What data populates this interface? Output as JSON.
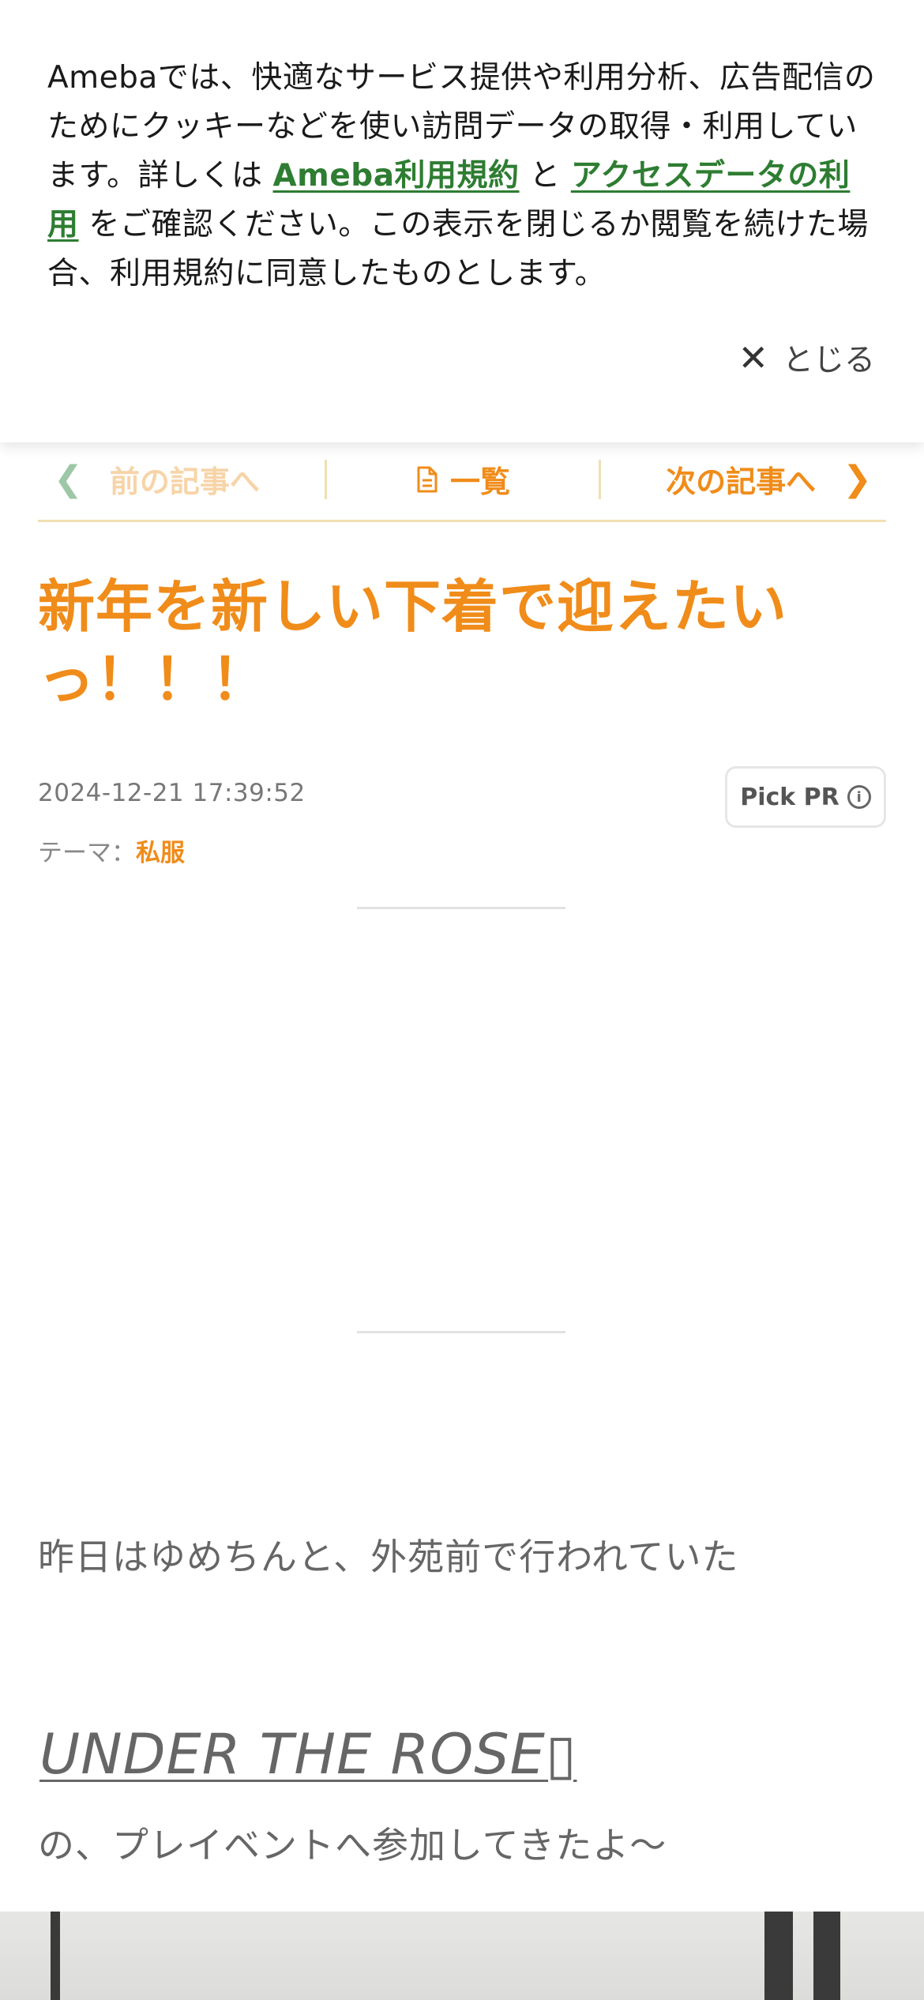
{
  "cookie_banner": {
    "text_before": "Amebaでは、快適なサービス提供や利用分析、広告配信のためにクッキーなどを使い訪問データの取得・利用しています。詳しくは ",
    "link_terms": "Ameba利用規約",
    "text_and": " と ",
    "link_access": "アクセスデータの利用",
    "text_after": " をご確認ください。この表示を閉じるか閲覧を続けた場合、利用規約に同意したものとします。",
    "close_label": "とじる"
  },
  "nav": {
    "prev_label": "前の記事へ",
    "list_label": "一覧",
    "next_label": "次の記事へ"
  },
  "entry": {
    "title": "新年を新しい下着で迎えたいっ！！！",
    "date": "2024-12-21 17:39:52",
    "theme_label": "テーマ：",
    "theme_value": "私服",
    "pick_pr_label": "Pick PR"
  },
  "body": {
    "line1": "昨日はゆめちんと、外苑前で行われていた",
    "link": "UNDER THE ROSE",
    "link_suffix_glyph": "▯",
    "line2": "の、プレイベントへ参加してきたよ〜"
  },
  "colors": {
    "accent_orange": "#f08c1a",
    "link_green": "#2e7d32"
  }
}
